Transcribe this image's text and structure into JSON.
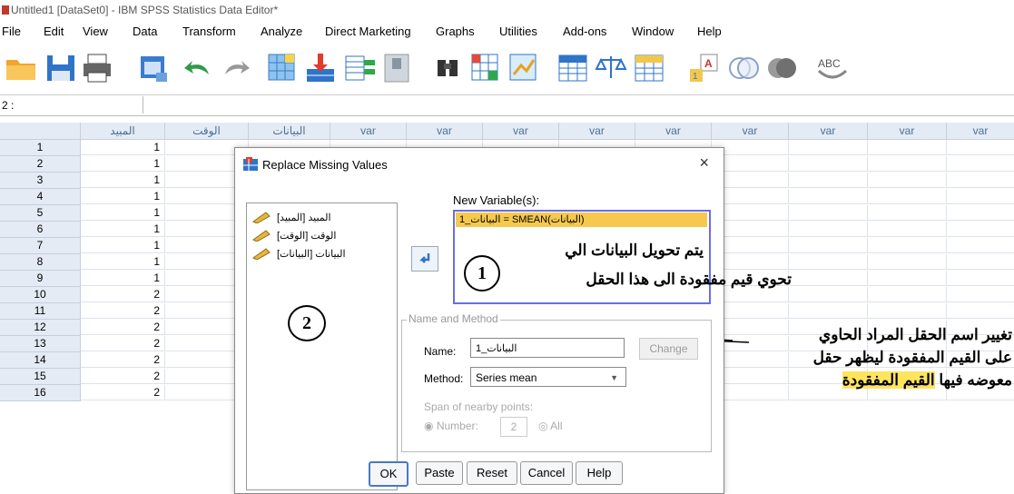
{
  "window": {
    "title": "Untitled1 [DataSet0] - IBM SPSS Statistics Data Editor*"
  },
  "menu": [
    "File",
    "Edit",
    "View",
    "Data",
    "Transform",
    "Analyze",
    "Direct Marketing",
    "Graphs",
    "Utilities",
    "Add-ons",
    "Window",
    "Help"
  ],
  "toolbar_icons": [
    "open-icon",
    "save-icon",
    "print-icon",
    "dialog-recall-icon",
    "undo-icon",
    "redo-icon",
    "goto-case-icon",
    "goto-variable-icon",
    "variables-icon",
    "split-file-icon",
    "find-icon",
    "insert-cases-icon",
    "insert-variable-icon",
    "select-cases-icon",
    "weight-cases-icon",
    "value-labels-icon",
    "use-sets-icon",
    "show-all-icon",
    "spell-icon"
  ],
  "cell_ref": {
    "label": "2 :",
    "value": ""
  },
  "grid": {
    "columns": [
      "المبيد",
      "الوقت",
      "البيانات",
      "var",
      "var",
      "var",
      "var",
      "var",
      "var",
      "var",
      "var",
      "var"
    ],
    "rows": [
      {
        "n": "1",
        "v": "1"
      },
      {
        "n": "2",
        "v": "1"
      },
      {
        "n": "3",
        "v": "1"
      },
      {
        "n": "4",
        "v": "1"
      },
      {
        "n": "5",
        "v": "1"
      },
      {
        "n": "6",
        "v": "1"
      },
      {
        "n": "7",
        "v": "1"
      },
      {
        "n": "8",
        "v": "1"
      },
      {
        "n": "9",
        "v": "1"
      },
      {
        "n": "10",
        "v": "2"
      },
      {
        "n": "11",
        "v": "2"
      },
      {
        "n": "12",
        "v": "2"
      },
      {
        "n": "13",
        "v": "2"
      },
      {
        "n": "14",
        "v": "2"
      },
      {
        "n": "15",
        "v": "2"
      },
      {
        "n": "16",
        "v": "2"
      }
    ]
  },
  "dialog": {
    "title": "Replace Missing Values",
    "close": "×",
    "variables": [
      "المبيد [المبيد]",
      "الوقت [الوقت]",
      "البيانات [البيانات]"
    ],
    "new_variables_label": "New Variable(s):",
    "new_variable_entry": "البيانات_1 = SMEAN(البيانات)",
    "group_label": "Name and Method",
    "name_label": "Name:",
    "name_value": "البيانات_1",
    "change_button": "Change",
    "method_label": "Method:",
    "method_value": "Series mean",
    "span_label": "Span of nearby points:",
    "number_label": "Number:",
    "number_value": "2",
    "all_label": "All",
    "buttons": {
      "ok": "OK",
      "paste": "Paste",
      "reset": "Reset",
      "cancel": "Cancel",
      "help": "Help"
    }
  },
  "annotations": {
    "one": {
      "number": "1",
      "line1": "يتم تحويل البيانات الي",
      "line2": "تحوي قيم مفقودة الى هذا الحقل"
    },
    "two": {
      "number": "2",
      "line1": "تغيير اسم الحقل المراد الحاوي",
      "line2": "على القيم المفقودة ليظهر حقل",
      "line3a": "معوضه فيها ",
      "line3b": "القيم",
      "line3c": " المفقودة"
    }
  }
}
